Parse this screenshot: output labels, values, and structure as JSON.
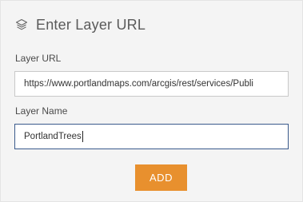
{
  "header": {
    "icon": "layers-icon",
    "title": "Enter Layer URL"
  },
  "form": {
    "url_label": "Layer URL",
    "url_value": "https://www.portlandmaps.com/arcgis/rest/services/Publi",
    "name_label": "Layer Name",
    "name_value": "PortlandTrees",
    "add_label": "ADD"
  },
  "colors": {
    "panel_bg": "#f4f4f4",
    "button_bg": "#e8902e",
    "focus_border": "#3a5a8c"
  }
}
